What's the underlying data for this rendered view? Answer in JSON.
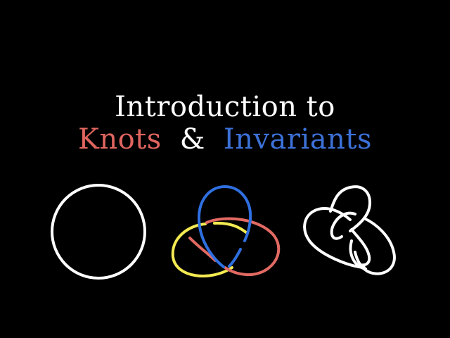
{
  "title": {
    "line1": "Introduction to",
    "knots_word": "Knots",
    "ampersand": "&",
    "invariants_word": "Invariants"
  },
  "colors": {
    "background": "#000000",
    "title_white": "#ffffff",
    "knots_red": "#e0655f",
    "invariants_blue": "#3c71d8",
    "knot_white": "#ffffff",
    "trefoil_blue": "#2f6fe0",
    "trefoil_red": "#e36a63",
    "trefoil_yellow": "#f4ea52"
  },
  "figures": [
    {
      "name": "unknot-circle"
    },
    {
      "name": "trefoil-knot"
    },
    {
      "name": "figure-eight-knot"
    }
  ]
}
